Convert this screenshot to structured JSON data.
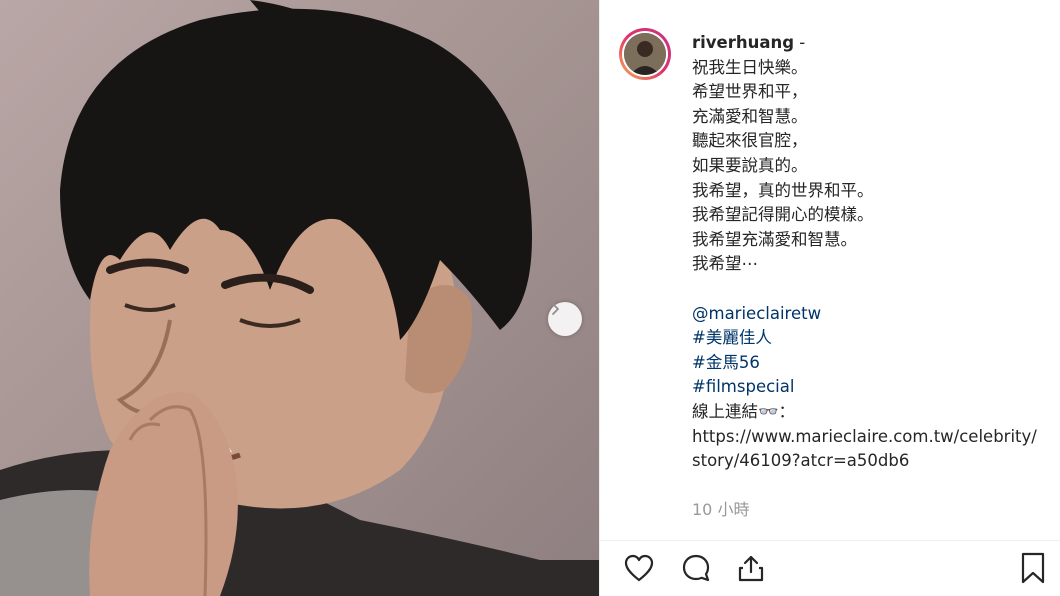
{
  "post": {
    "username": "riverhuang",
    "separator": " -",
    "caption_lines": [
      "祝我生日快樂。",
      "希望世界和平，",
      "充滿愛和智慧。",
      "聽起來很官腔，",
      "如果要說真的。",
      "我希望，真的世界和平。",
      "我希望記得開心的模樣。",
      "我希望充滿愛和智慧。",
      "我希望⋯"
    ],
    "mention": "@marieclairetw",
    "hashtags": [
      "#美麗佳人",
      "#金馬56",
      "#filmspecial"
    ],
    "link_label": "線上連結👓：",
    "link_url": "https://www.marieclaire.com.tw/celebrity/story/46109?atcr=a50db6",
    "timestamp": "10 小時"
  },
  "icons": {
    "next": "chevron-right-icon",
    "like": "heart-icon",
    "comment": "comment-bubble-icon",
    "share": "share-icon",
    "save": "bookmark-icon"
  },
  "colors": {
    "text": "#262626",
    "link": "#003569",
    "muted": "#999999",
    "ring_start": "#f6b354",
    "ring_end": "#c13584"
  }
}
